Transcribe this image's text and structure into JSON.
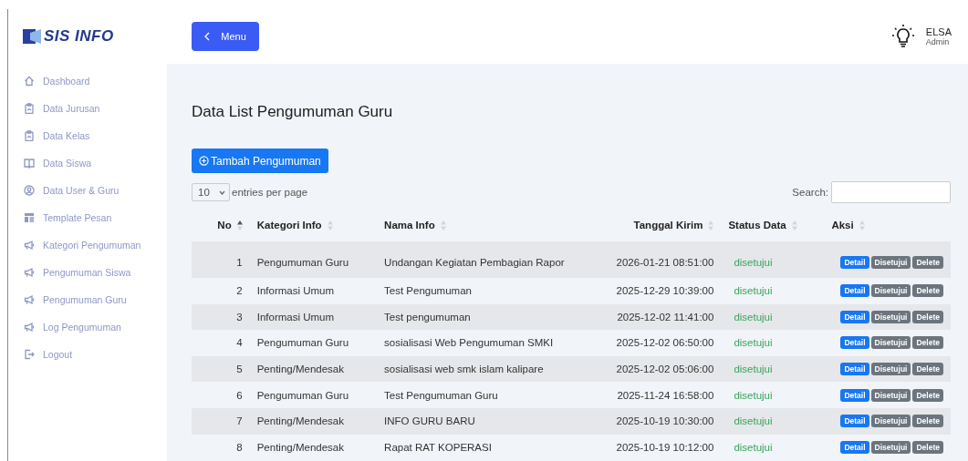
{
  "logo": {
    "text": "SIS INFO"
  },
  "header": {
    "menu_button": "Menu",
    "user": {
      "name": "ELSA",
      "role": "Admin"
    }
  },
  "sidebar": {
    "items": [
      {
        "label": "Dashboard"
      },
      {
        "label": "Data Jurusan"
      },
      {
        "label": "Data Kelas"
      },
      {
        "label": "Data Siswa"
      },
      {
        "label": "Data User & Guru"
      },
      {
        "label": "Template Pesan"
      },
      {
        "label": "Kategori Pengumuman"
      },
      {
        "label": "Pengumuman Siswa"
      },
      {
        "label": "Pengumuman Guru"
      },
      {
        "label": "Log Pengumuman"
      },
      {
        "label": "Logout"
      }
    ]
  },
  "page_title": "Data List Pengumuman Guru",
  "add_button": "Tambah Pengumuman",
  "entries": {
    "value": "10",
    "label": "entries per page"
  },
  "search": {
    "label": "Search:"
  },
  "table": {
    "columns": [
      {
        "label": "No",
        "sorted": true
      },
      {
        "label": "Kategori Info",
        "sorted": false
      },
      {
        "label": "Nama Info",
        "sorted": false
      },
      {
        "label": "Tanggal Kirim",
        "sorted": false
      },
      {
        "label": "Status Data",
        "sorted": false
      },
      {
        "label": "Aksi",
        "sorted": false
      }
    ],
    "rows": [
      {
        "no": "1",
        "kategori": "Pengumuman Guru",
        "nama": "Undangan Kegiatan Pembagian Rapor",
        "tanggal": "2026-01-21 08:51:00",
        "status": "disetujui",
        "actions": [
          {
            "label": "Detail",
            "kind": "primary"
          },
          {
            "label": "Disetujui",
            "kind": "secondary"
          },
          {
            "label": "Delete",
            "kind": "secondary"
          }
        ]
      },
      {
        "no": "2",
        "kategori": "Informasi Umum",
        "nama": "Test Pengumuman",
        "tanggal": "2025-12-29 10:39:00",
        "status": "disetujui",
        "actions": [
          {
            "label": "Detail",
            "kind": "primary"
          },
          {
            "label": "Disetujui",
            "kind": "secondary"
          },
          {
            "label": "Delete",
            "kind": "secondary"
          }
        ]
      },
      {
        "no": "3",
        "kategori": "Informasi Umum",
        "nama": "Test pengumuman",
        "tanggal": "2025-12-02 11:41:00",
        "status": "disetujui",
        "actions": [
          {
            "label": "Detail",
            "kind": "primary"
          },
          {
            "label": "Disetujui",
            "kind": "secondary"
          },
          {
            "label": "Delete",
            "kind": "secondary"
          }
        ]
      },
      {
        "no": "4",
        "kategori": "Pengumuman Guru",
        "nama": "sosialisasi Web Pengumuman SMKI",
        "tanggal": "2025-12-02 06:50:00",
        "status": "disetujui",
        "actions": [
          {
            "label": "Detail",
            "kind": "primary"
          },
          {
            "label": "Disetujui",
            "kind": "secondary"
          },
          {
            "label": "Delete",
            "kind": "secondary"
          }
        ]
      },
      {
        "no": "5",
        "kategori": "Penting/Mendesak",
        "nama": "sosialisasi web smk islam kalipare",
        "tanggal": "2025-12-02 05:06:00",
        "status": "disetujui",
        "actions": [
          {
            "label": "Detail",
            "kind": "primary"
          },
          {
            "label": "Disetujui",
            "kind": "secondary"
          },
          {
            "label": "Delete",
            "kind": "secondary"
          }
        ]
      },
      {
        "no": "6",
        "kategori": "Pengumuman Guru",
        "nama": "Test Pengumuman Guru",
        "tanggal": "2025-11-24 16:58:00",
        "status": "disetujui",
        "actions": [
          {
            "label": "Detail",
            "kind": "primary"
          },
          {
            "label": "Disetujui",
            "kind": "secondary"
          },
          {
            "label": "Delete",
            "kind": "secondary"
          }
        ]
      },
      {
        "no": "7",
        "kategori": "Penting/Mendesak",
        "nama": "INFO GURU BARU",
        "tanggal": "2025-10-19 10:30:00",
        "status": "disetujui",
        "actions": [
          {
            "label": "Detail",
            "kind": "primary"
          },
          {
            "label": "Disetujui",
            "kind": "secondary"
          },
          {
            "label": "Delete",
            "kind": "secondary"
          }
        ]
      },
      {
        "no": "8",
        "kategori": "Penting/Mendesak",
        "nama": "Rapat RAT KOPERASI",
        "tanggal": "2025-10-19 10:12:00",
        "status": "disetujui",
        "actions": [
          {
            "label": "Detail",
            "kind": "primary"
          },
          {
            "label": "Disetujui",
            "kind": "secondary"
          },
          {
            "label": "Delete",
            "kind": "secondary"
          }
        ]
      }
    ]
  }
}
